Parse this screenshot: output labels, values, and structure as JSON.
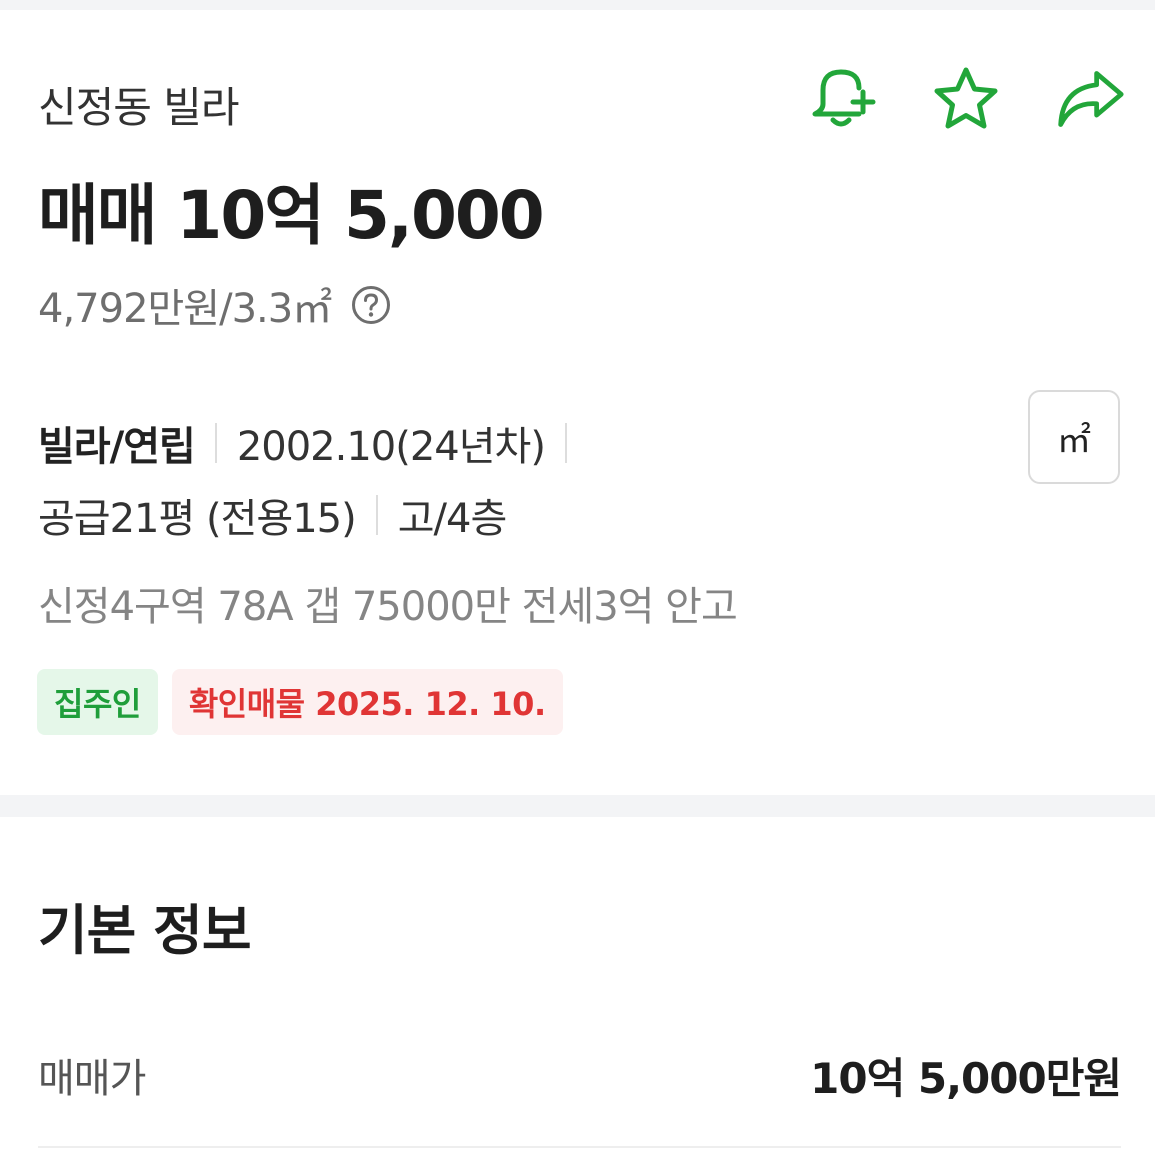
{
  "listing": {
    "place_name": "신정동 빌라",
    "deal_price": "매매 10억 5,000",
    "unit_price": "4,792만원/3.3㎡",
    "help_icon": "question-circle-icon"
  },
  "actions": [
    {
      "name": "alert-add-icon",
      "color": "#22a63a"
    },
    {
      "name": "star-icon",
      "color": "#22a63a"
    },
    {
      "name": "share-icon",
      "color": "#22a63a"
    }
  ],
  "specs": {
    "type": "빌라/연립",
    "built": "2002.10(24년차)",
    "area": "공급21평 (전용15)",
    "floor": "고/4층"
  },
  "unit_toggle": {
    "label": "㎡"
  },
  "description": "신정4구역 78A 갭 75000만 전세3억 안고",
  "tags": {
    "owner": "집주인",
    "verified": "확인매물 2025. 12. 10."
  },
  "colors": {
    "accent_green": "#22a63a",
    "tag_owner_bg": "#e5f7e9",
    "tag_owner_text": "#1f9e3a",
    "tag_verified_bg": "#fdf0f0",
    "tag_verified_text": "#e03535"
  },
  "basic_info": {
    "title": "기본 정보",
    "rows": [
      {
        "label": "매매가",
        "value": "10억 5,000만원"
      }
    ]
  }
}
